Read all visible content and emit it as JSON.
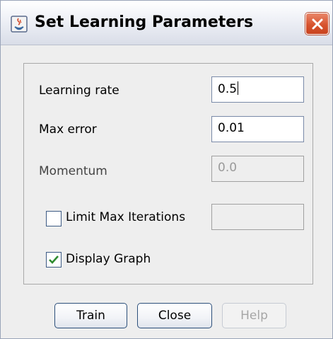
{
  "window": {
    "title": "Set Learning Parameters"
  },
  "form": {
    "learning_rate_label": "Learning rate",
    "learning_rate_value": "0.5",
    "max_error_label": "Max error",
    "max_error_value": "0.01",
    "momentum_label": "Momentum",
    "momentum_value": "0.0",
    "limit_iterations_label": "Limit Max Iterations",
    "limit_iterations_checked": false,
    "max_iterations_value": "",
    "display_graph_label": "Display Graph",
    "display_graph_checked": true
  },
  "buttons": {
    "train": "Train",
    "close": "Close",
    "help": "Help"
  },
  "colors": {
    "close_button": "#d8542f",
    "checkmark": "#2e8b2e",
    "border": "#2c4f7a"
  }
}
